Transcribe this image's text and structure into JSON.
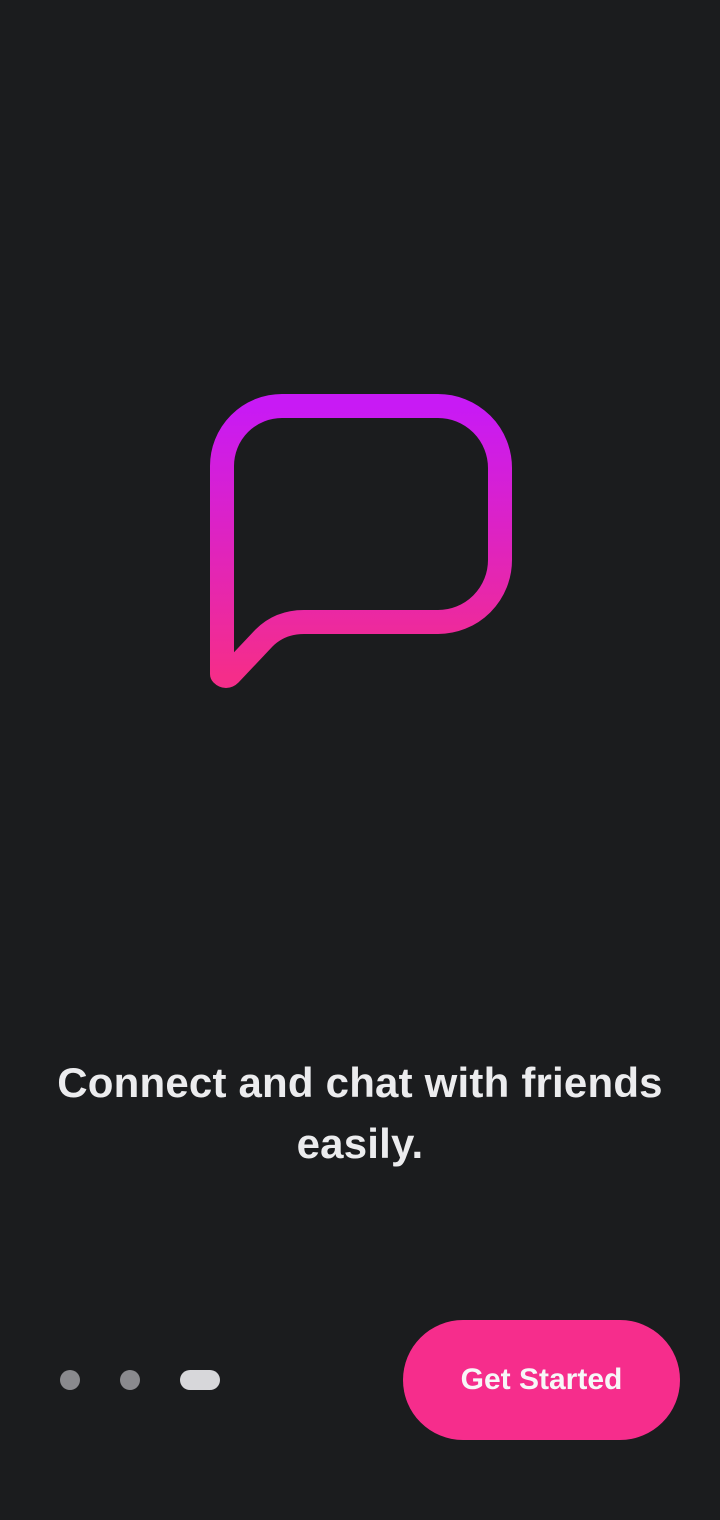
{
  "onboarding": {
    "illustration_icon": "chat-bubble-icon",
    "gradient": {
      "start": "#c81af5",
      "end": "#f52d8a"
    },
    "headline": "Connect and chat with friends easily.",
    "pager": {
      "total_pages": 3,
      "current_page": 3,
      "inactive_color": "#8a8a8e",
      "active_color": "#d7d7da"
    },
    "primary_button": {
      "label": "Get Started",
      "color": "#f62d8c"
    }
  }
}
